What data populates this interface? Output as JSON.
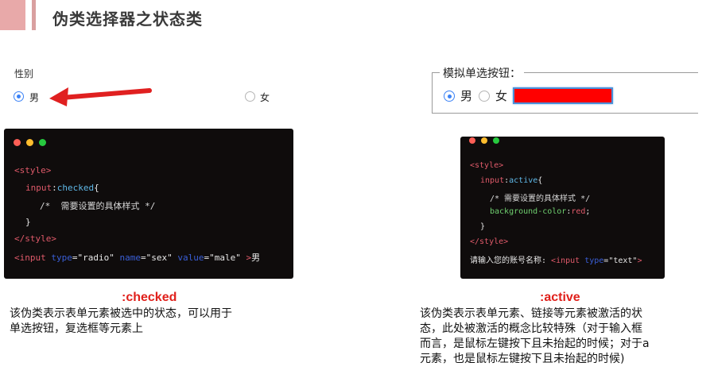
{
  "header": {
    "title": "伪类选择器之状态类"
  },
  "left_demo": {
    "label": "性别",
    "option_male": "男",
    "option_female": "女"
  },
  "right_demo": {
    "legend": "模拟单选按钮：",
    "option_male": "男",
    "option_female": "女",
    "input_color": "#ff0000"
  },
  "code_checked": {
    "lines": [
      [
        "<style>"
      ],
      [
        "input",
        ":",
        "checked",
        "{"
      ],
      [
        "/*  需要设置的具体样式 */"
      ],
      [
        "}"
      ],
      [
        "</style>"
      ],
      [
        "<input ",
        "type",
        "=",
        "\"radio\"",
        " name",
        "=",
        "\"sex\"",
        " value",
        "=",
        "\"male\"",
        " >",
        "男"
      ]
    ]
  },
  "code_active": {
    "lines": [
      [
        "<style>"
      ],
      [
        "input",
        ":",
        "active",
        "{"
      ],
      [
        "/* 需要设置的具体样式 */"
      ],
      [
        "background-color",
        ":",
        "red",
        ";"
      ],
      [
        "}"
      ],
      [
        "</style>"
      ],
      [
        "请输入您的账号名称: ",
        "<input ",
        "type",
        "=",
        "\"text\"",
        ">"
      ]
    ]
  },
  "caption_checked": {
    "title": ":checked",
    "text_line1": "该伪类表示表单元素被选中的状态，可以用于",
    "text_line2": "单选按钮，复选框等元素上"
  },
  "caption_active": {
    "title": ":active",
    "text_line1": "该伪类表示表单元素、链接等元素被激活的状",
    "text_line2": "态，此处被激活的概念比较特殊（对于输入框",
    "text_line3": "而言，是鼠标左键按下且未抬起的时候；对于a",
    "text_line4": "元素，也是鼠标左键按下且未抬起的时候)"
  },
  "colors": {
    "accent": "#e8a9a9",
    "red": "#e0201b",
    "arrow": "#e02020",
    "radio_blue": "#3b82f6"
  },
  "icons": {
    "arrow": "left-arrow-icon"
  }
}
